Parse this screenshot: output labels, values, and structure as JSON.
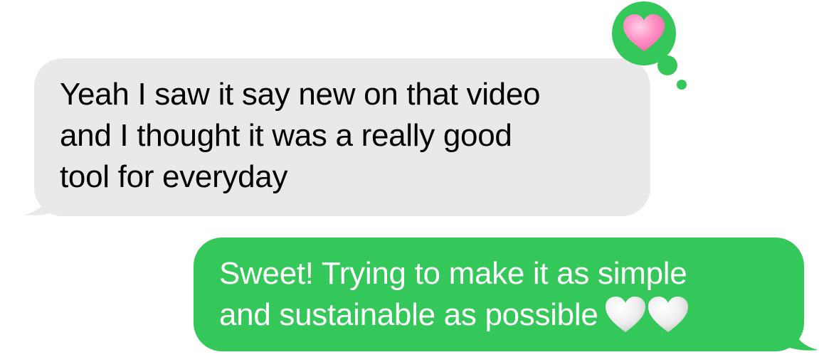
{
  "conversation": {
    "messages": [
      {
        "direction": "incoming",
        "lines": [
          "Yeah I saw it say new on that video",
          "and I thought it was a really good",
          "tool for everyday"
        ],
        "tapback": "heart-reaction",
        "tapback_color": "#34c759",
        "heart_color": "#ff8fc4"
      },
      {
        "direction": "outgoing",
        "lines": [
          "Sweet! Trying to make it as simple",
          "and sustainable as possible"
        ],
        "trailing_emoji": [
          "white-heart-icon",
          "white-heart-icon"
        ]
      }
    ]
  },
  "colors": {
    "incoming_bubble": "#e9e9eb",
    "outgoing_bubble": "#34c759",
    "incoming_text": "#000000",
    "outgoing_text": "#ffffff"
  }
}
